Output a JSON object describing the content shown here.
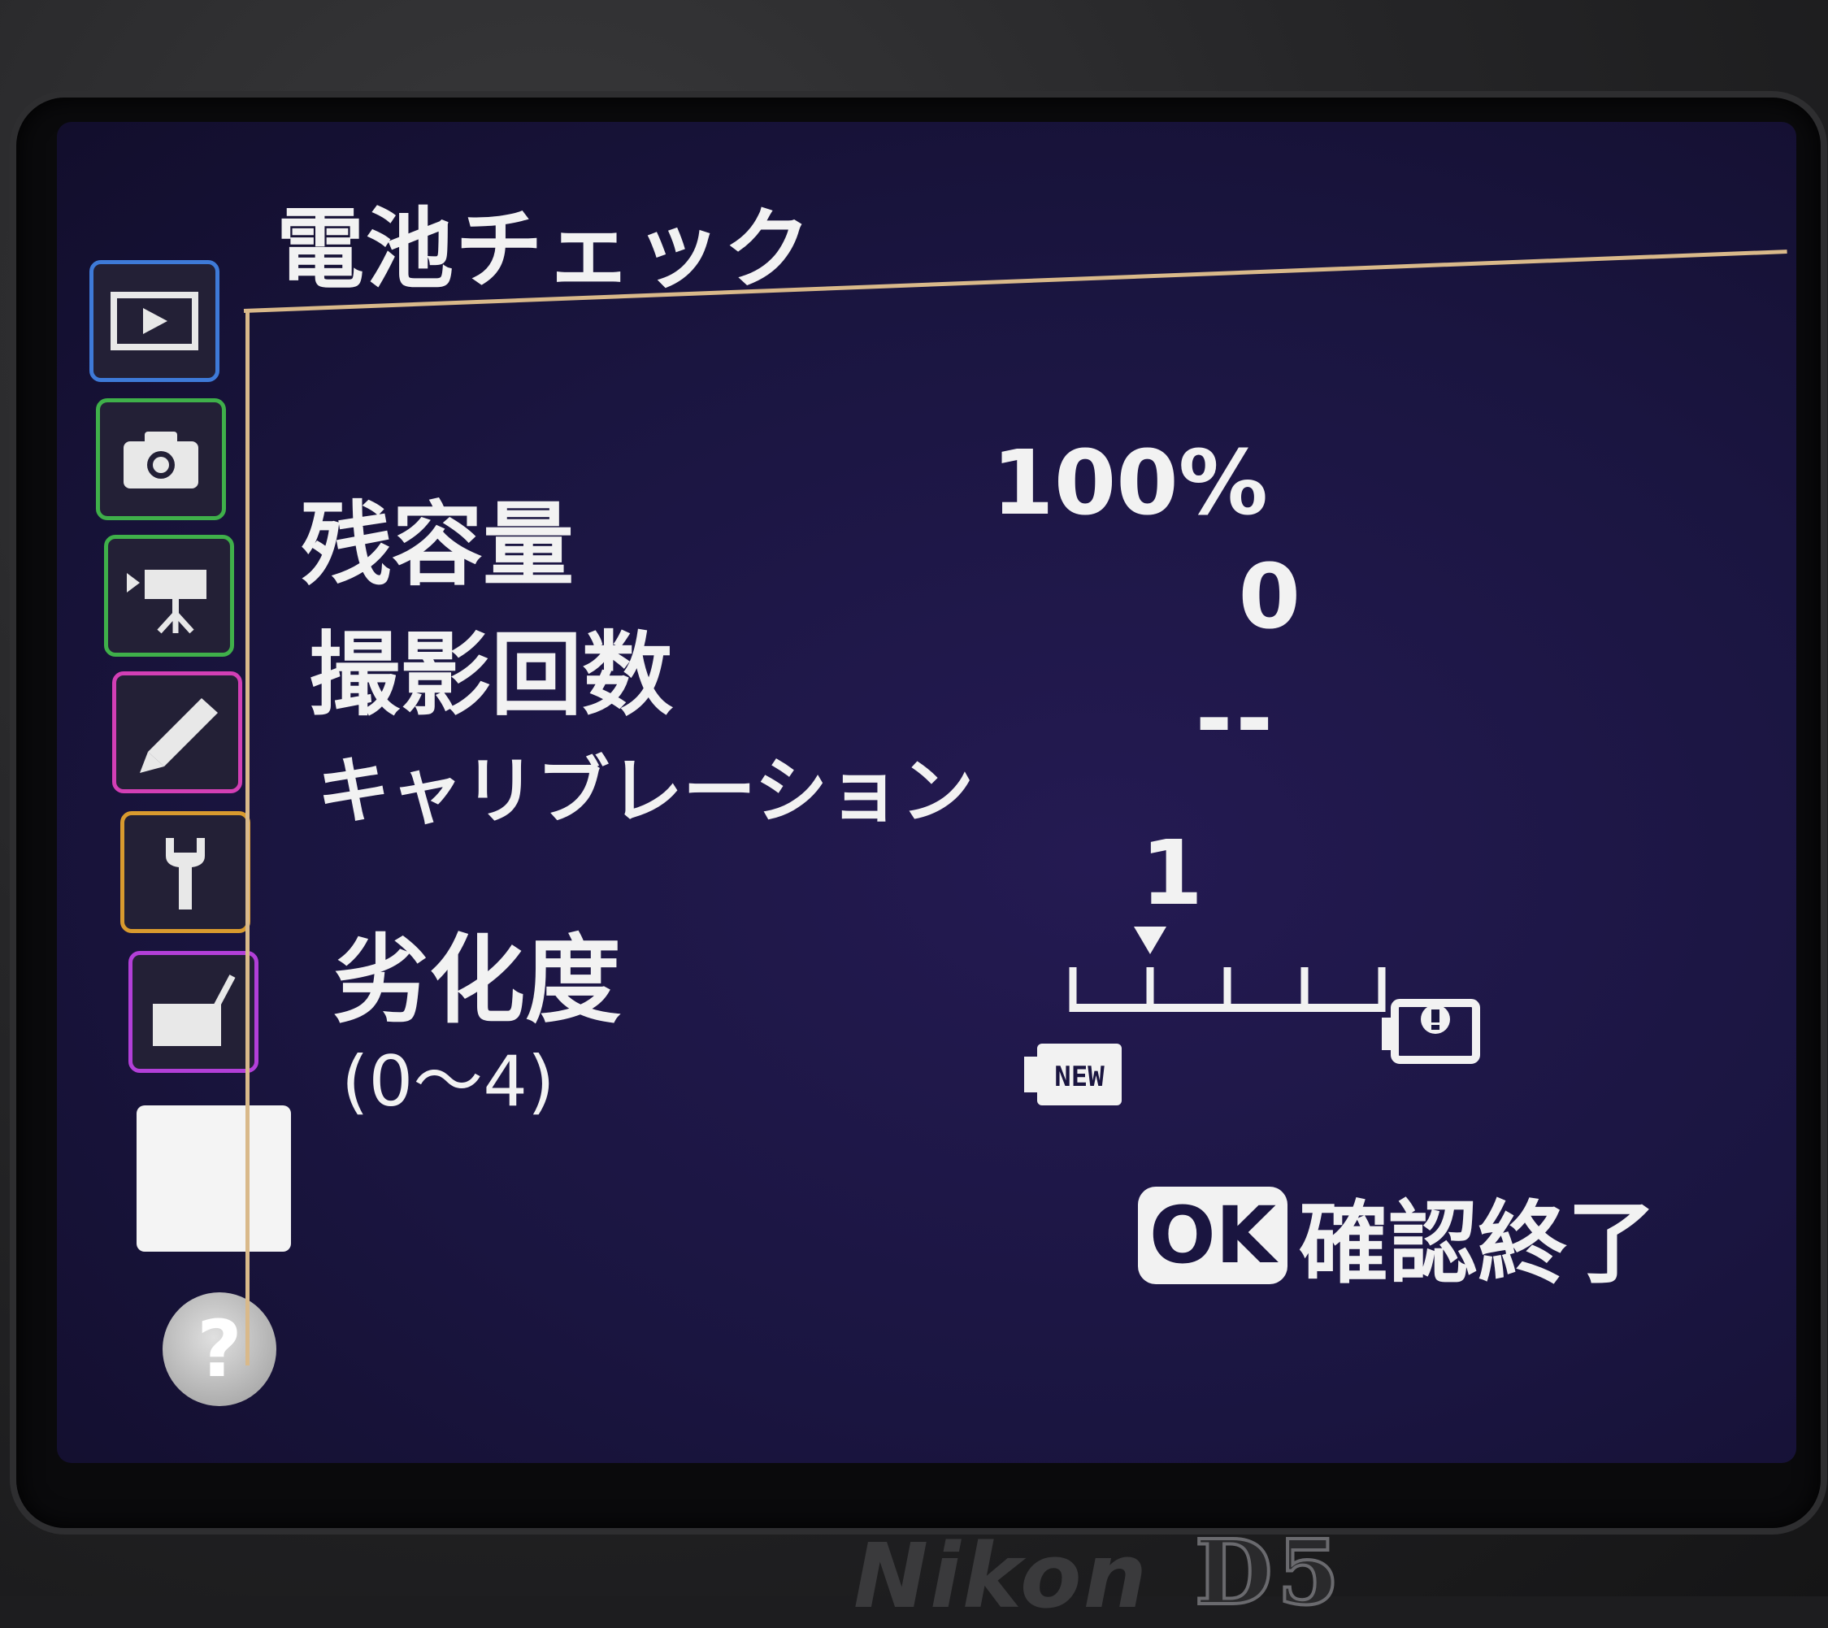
{
  "screen": {
    "title": "電池チェック",
    "rows": {
      "remaining_label": "残容量",
      "remaining_value": "100%",
      "shots_label": "撮影回数",
      "shots_value": "0",
      "calibration_label": "キャリブレーション",
      "calibration_value": "--",
      "aging_label": "劣化度",
      "aging_range": "(0〜4)",
      "aging_value": "1"
    },
    "gauge": {
      "level": 1,
      "max": 4,
      "new_label": "NEW"
    },
    "ok_prompt": {
      "badge": "OK",
      "label": "確認終了"
    }
  },
  "sidebar": {
    "icons": [
      "playback-icon",
      "shooting-icon",
      "movie-icon",
      "custom-settings-icon",
      "setup-icon",
      "retouch-icon",
      "my-menu-icon"
    ],
    "help": "?"
  },
  "body": {
    "brand": "Nikon",
    "model": "D5"
  },
  "colors": {
    "screen_bg": "#1a1540",
    "text": "#f2f2f2",
    "frame": "#d9b98a",
    "playback_tab": "#3e7ad8",
    "shooting_tab": "#3fb04a",
    "custom_tab": "#d23fb5",
    "setup_tab": "#d89a2e",
    "retouch_tab": "#b23fd8"
  }
}
